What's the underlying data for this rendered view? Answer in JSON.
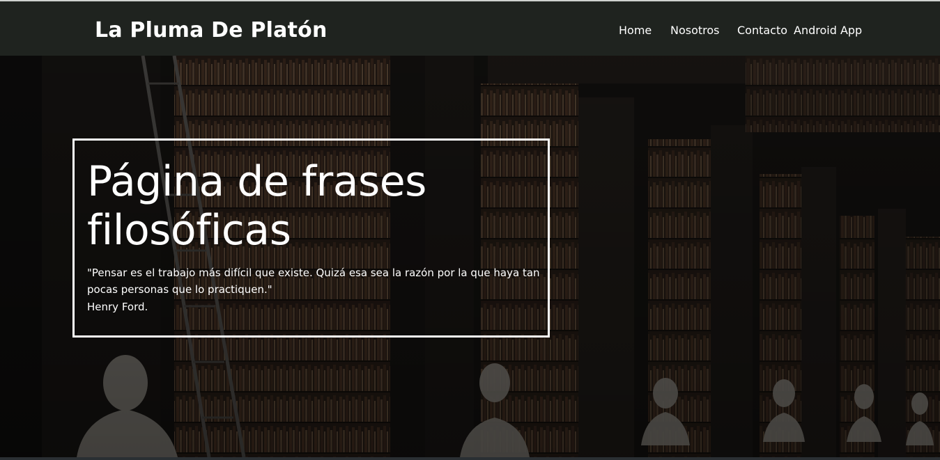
{
  "header": {
    "brand": "La Pluma De Platón",
    "nav": [
      {
        "label": "Home"
      },
      {
        "label": "Nosotros"
      },
      {
        "label": "Contacto"
      },
      {
        "label": "Android App"
      }
    ]
  },
  "hero": {
    "background_description_icon": "library-bookshelves-image",
    "headline": "Página de frases filosóficas",
    "quote": "\"Pensar es el trabajo más difícil que existe. Quizá esa sea la razón por la que haya tan pocas personas que lo practiquen.\"",
    "author": "Henry Ford."
  },
  "colors": {
    "topbar": "#1f231f",
    "text": "#ffffff",
    "box_border": "#ffffff"
  }
}
